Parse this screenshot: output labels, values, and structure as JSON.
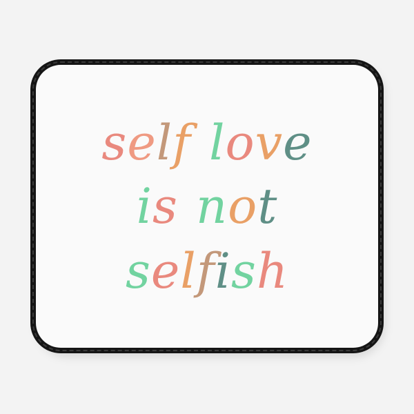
{
  "product": {
    "type": "mouse-pad"
  },
  "design": {
    "lines": [
      [
        {
          "t": "s",
          "c": "#e9897e"
        },
        {
          "t": "e",
          "c": "#ef9a82"
        },
        {
          "t": "l",
          "c": "#c3987a"
        },
        {
          "t": "f",
          "c": "#e9a066"
        },
        {
          "t": " ",
          "c": ""
        },
        {
          "t": "l",
          "c": "#72d3a0"
        },
        {
          "t": "o",
          "c": "#e9897e"
        },
        {
          "t": "v",
          "c": "#e9a066"
        },
        {
          "t": "e",
          "c": "#5f8f86"
        }
      ],
      [
        {
          "t": "i",
          "c": "#72d3a0"
        },
        {
          "t": "s",
          "c": "#e9897e"
        },
        {
          "t": " ",
          "c": ""
        },
        {
          "t": "n",
          "c": "#72d3a0"
        },
        {
          "t": "o",
          "c": "#e9a066"
        },
        {
          "t": "t",
          "c": "#5f8f86"
        }
      ],
      [
        {
          "t": "s",
          "c": "#72d3a0"
        },
        {
          "t": "e",
          "c": "#e9897e"
        },
        {
          "t": "l",
          "c": "#e9a066"
        },
        {
          "t": "f",
          "c": "#c3987a"
        },
        {
          "t": "i",
          "c": "#5f8f86"
        },
        {
          "t": "s",
          "c": "#72d3a0"
        },
        {
          "t": "h",
          "c": "#e9897e"
        }
      ]
    ],
    "colors": {
      "coral": "#e9897e",
      "orange": "#e9a066",
      "tan": "#c3987a",
      "mint": "#72d3a0",
      "teal": "#5f8f86",
      "border": "#151515",
      "surface": "#fafafa"
    }
  }
}
